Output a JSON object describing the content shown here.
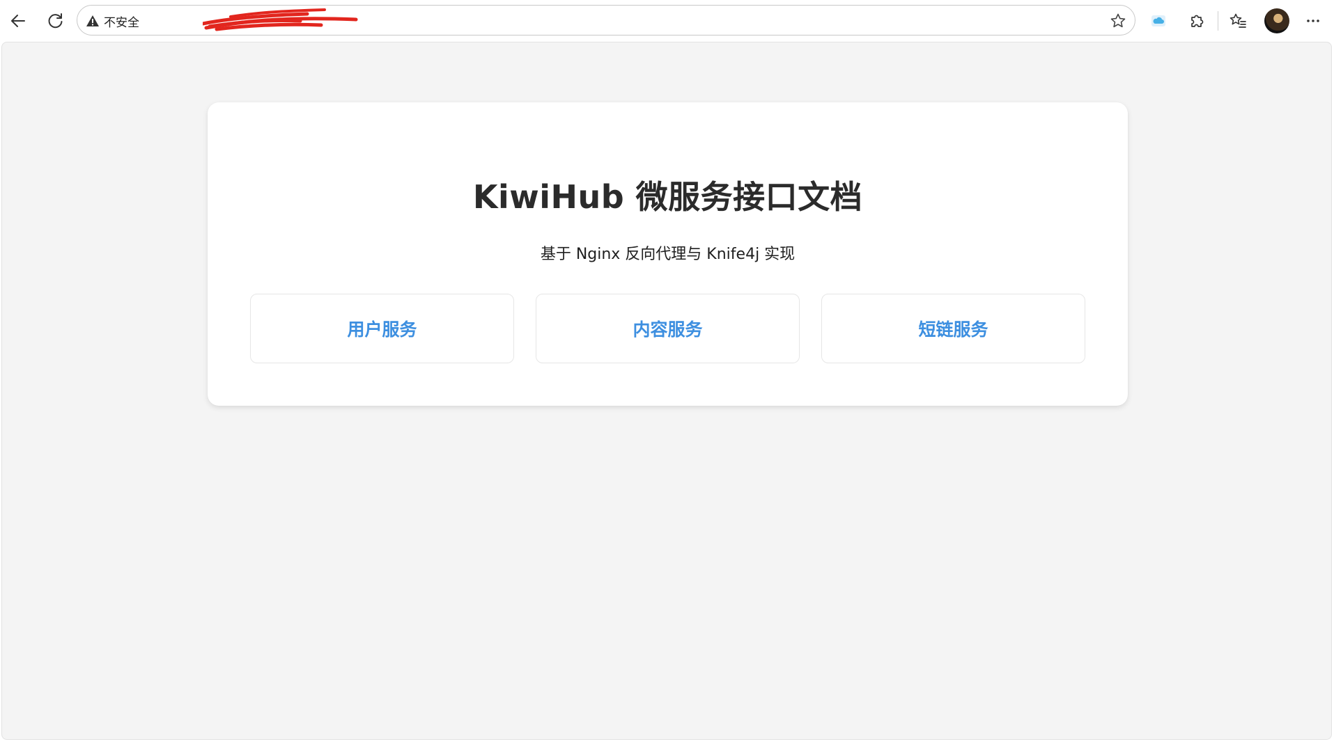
{
  "browser": {
    "security_label": "不安全",
    "colors": {
      "accent": "#3d8fe0",
      "redaction": "#e2261e"
    },
    "icons": {
      "back": "back-arrow-icon",
      "reload": "reload-icon",
      "warning": "warning-triangle-icon",
      "favorite": "star-icon",
      "cloud": "cloud-icon",
      "extensions": "puzzle-icon",
      "favorites_list": "favorites-icon",
      "menu": "more-icon"
    }
  },
  "page": {
    "title": "KiwiHub 微服务接口文档",
    "subtitle": "基于 Nginx 反向代理与 Knife4j 实现",
    "services": [
      {
        "label": "用户服务"
      },
      {
        "label": "内容服务"
      },
      {
        "label": "短链服务"
      }
    ]
  }
}
